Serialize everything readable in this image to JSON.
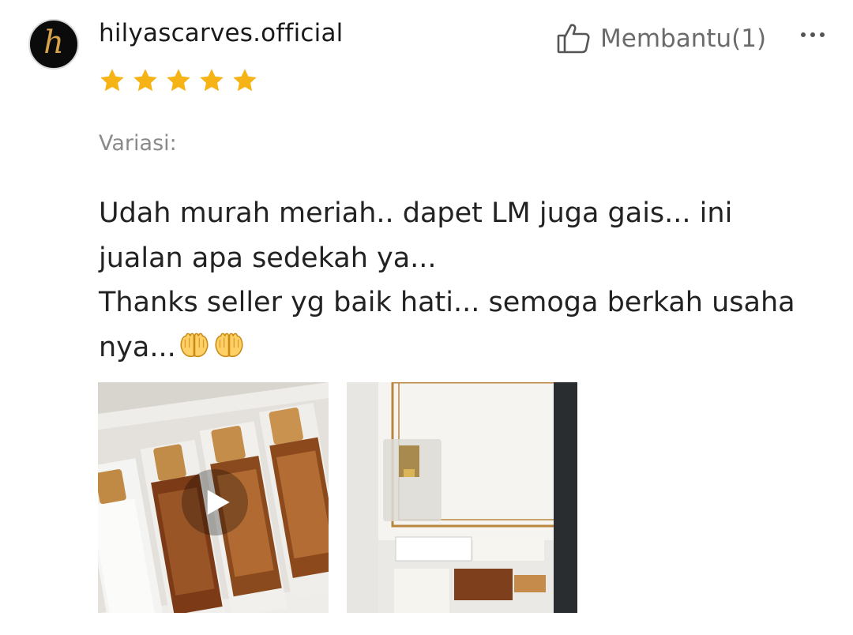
{
  "review": {
    "avatar_letter": "h",
    "username": "hilyascarves.official",
    "rating": 5,
    "rating_max": 5,
    "helpful_label": "Membantu(1)",
    "variant_label": "Variasi:",
    "text": "Udah murah meriah.. dapet LM juga gais... ini\njualan apa sedekah ya...\nThanks seller yg baik hati... semoga berkah usaha\nnya...",
    "emoji": [
      "palms-up-together",
      "palms-up-together"
    ],
    "media": [
      {
        "type": "video",
        "description_icon": "play-icon"
      },
      {
        "type": "image"
      }
    ]
  },
  "colors": {
    "star": "#f5b316",
    "username": "#1a1a1a",
    "muted": "#8a8a8a",
    "text": "#222222",
    "avatar_bg": "#0b0b0b",
    "avatar_letter": "#d6a24a"
  },
  "icons": {
    "helpful": "thumbs-up-icon",
    "more": "more-dots-icon",
    "star": "star-icon",
    "play": "play-icon"
  }
}
